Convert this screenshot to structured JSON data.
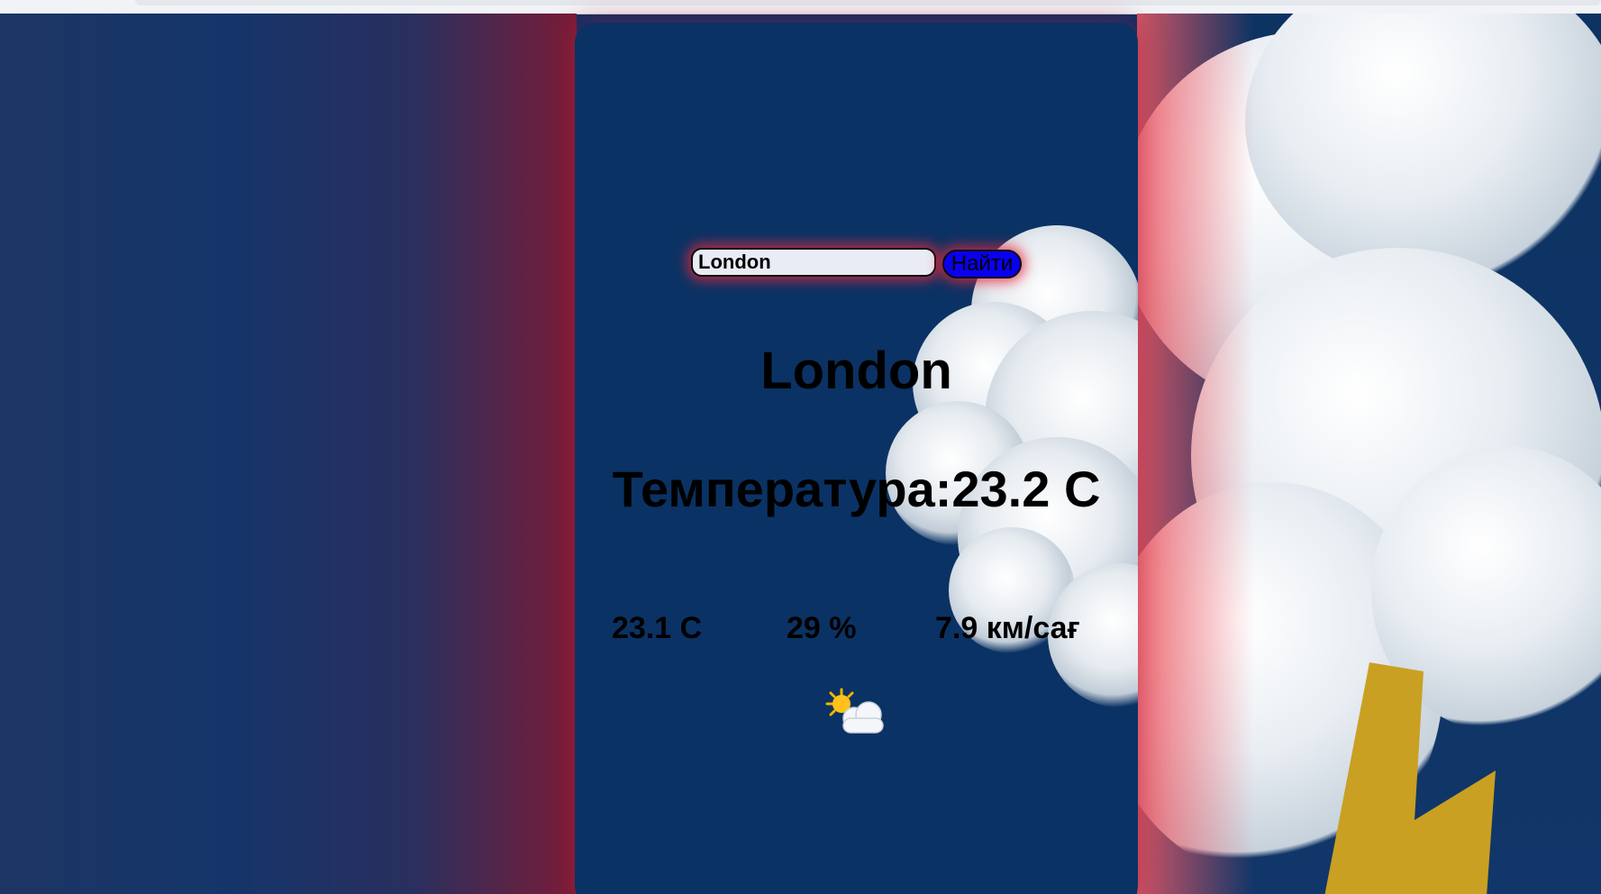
{
  "search": {
    "value": "London",
    "button_label": "Найти"
  },
  "weather": {
    "city": "London",
    "temperature_text": "Температура:23.2 C",
    "feels_like": "23.1 C",
    "humidity": "29 %",
    "wind": "7.9 км/сағ",
    "icon": "partly-cloudy-icon"
  },
  "colors": {
    "card_background": "#0b3264",
    "button_background": "#0a00f0",
    "glow": "#e6283c"
  }
}
